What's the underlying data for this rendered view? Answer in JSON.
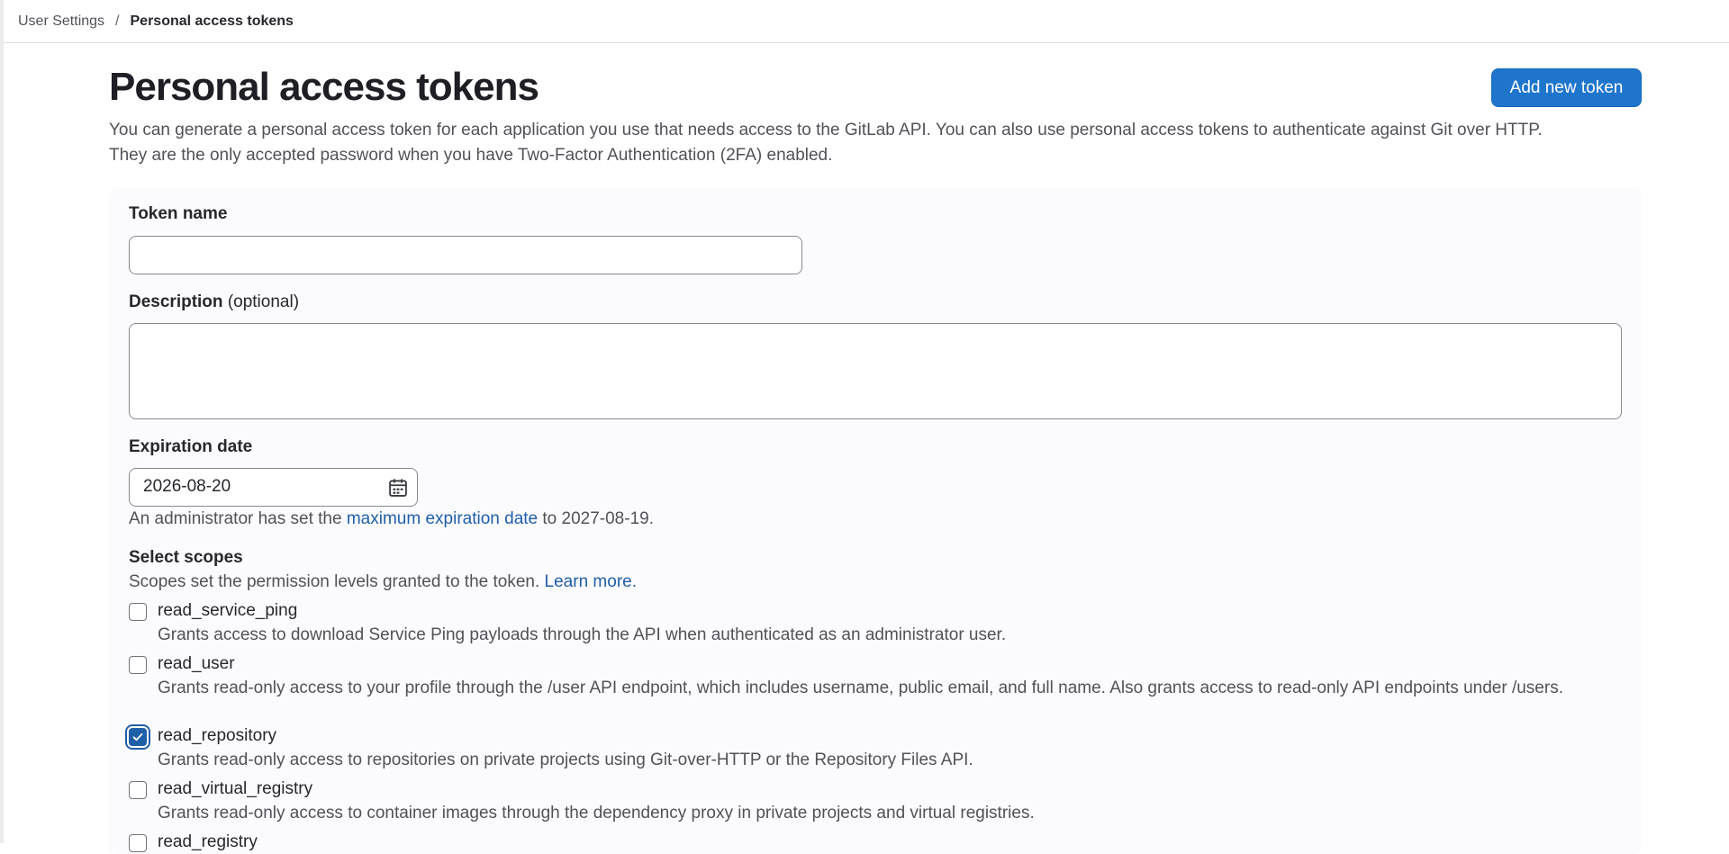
{
  "breadcrumb": {
    "parent": "User Settings",
    "separator": "/",
    "current": "Personal access tokens"
  },
  "page": {
    "title": "Personal access tokens",
    "add_button": "Add new token",
    "intro_line1": "You can generate a personal access token for each application you use that needs access to the GitLab API. You can also use personal access tokens to authenticate against Git over HTTP.",
    "intro_line2": "They are the only accepted password when you have Two-Factor Authentication (2FA) enabled."
  },
  "form": {
    "token_name_label": "Token name",
    "token_name_value": "",
    "description_label": "Description",
    "description_optional": "(optional)",
    "description_value": "",
    "expiration_label": "Expiration date",
    "expiration_value": "2026-08-20",
    "expiration_help_prefix": "An administrator has set the ",
    "expiration_help_link": "maximum expiration date",
    "expiration_help_suffix": " to 2027-08-19.",
    "scopes_label": "Select scopes",
    "scopes_help_prefix": "Scopes set the permission levels granted to the token. ",
    "scopes_help_link": "Learn more."
  },
  "scopes": [
    {
      "name": "read_service_ping",
      "checked": false,
      "description": "Grants access to download Service Ping payloads through the API when authenticated as an administrator user."
    },
    {
      "name": "read_user",
      "checked": false,
      "description": "Grants read-only access to your profile through the /user API endpoint, which includes username, public email, and full name. Also grants access to read-only API endpoints under /users."
    },
    {
      "name": "read_repository",
      "checked": true,
      "description": "Grants read-only access to repositories on private projects using Git-over-HTTP or the Repository Files API."
    },
    {
      "name": "read_virtual_registry",
      "checked": false,
      "description": "Grants read-only access to container images through the dependency proxy in private projects and virtual registries."
    },
    {
      "name": "read_registry",
      "checked": false,
      "description": ""
    }
  ],
  "colors": {
    "primary": "#1f75cb",
    "link": "#1f5fa8",
    "panel_bg": "#fbfafd"
  },
  "icons": {
    "calendar": "calendar-icon",
    "check": "check-icon"
  }
}
